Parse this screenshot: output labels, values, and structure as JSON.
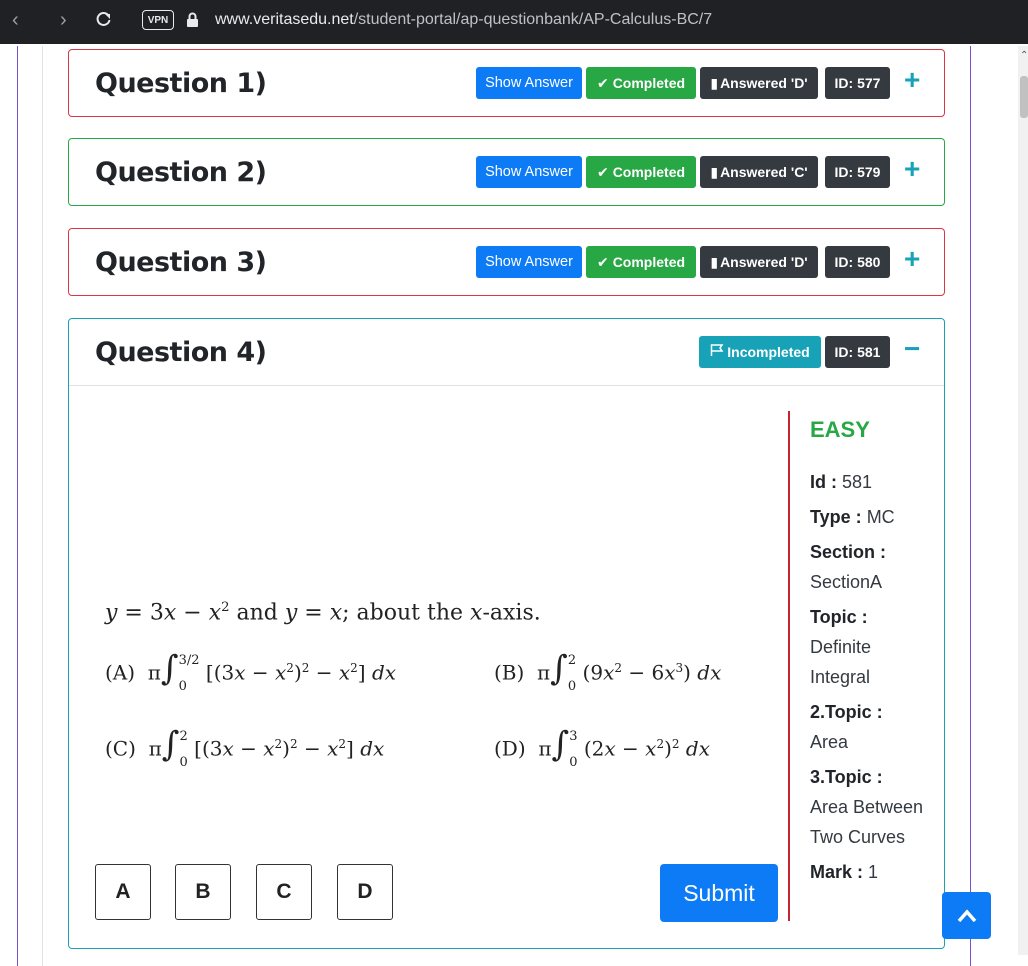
{
  "browser": {
    "url_host": "www.veritasedu.net",
    "url_path": "/student-portal/ap-questionbank/AP-Calculus-BC/7",
    "vpn_label": "VPN"
  },
  "questions": [
    {
      "title": "Question 1)",
      "show_answer": "Show Answer",
      "status": "Completed",
      "answered": "Answered 'D'",
      "id": "ID: 577",
      "toggle": "+",
      "border": "#dc3545"
    },
    {
      "title": "Question 2)",
      "show_answer": "Show Answer",
      "status": "Completed",
      "answered": "Answered 'C'",
      "id": "ID: 579",
      "toggle": "+",
      "border": "#28a745"
    },
    {
      "title": "Question 3)",
      "show_answer": "Show Answer",
      "status": "Completed",
      "answered": "Answered 'D'",
      "id": "ID: 580",
      "toggle": "+",
      "border": "#dc3545"
    },
    {
      "title": "Question 4)",
      "status": "Incompleted",
      "id": "ID: 581",
      "toggle": "−",
      "border": "#17a2b8"
    }
  ],
  "q4": {
    "stem": "y = 3x − x² and y = x; about the x-axis.",
    "options": {
      "A": {
        "label": "(A)",
        "expr": "π ∫₀^{3/2} [(3x − x²)² − x²] dx"
      },
      "B": {
        "label": "(B)",
        "expr": "π ∫₀^{2} (9x² − 6x³) dx"
      },
      "C": {
        "label": "(C)",
        "expr": "π ∫₀^{2} [(3x − x²)² − x²] dx"
      },
      "D": {
        "label": "(D)",
        "expr": "π ∫₀^{3} (2x − x²)² dx"
      }
    },
    "answer_buttons": [
      "A",
      "B",
      "C",
      "D"
    ],
    "submit": "Submit",
    "difficulty": "EASY",
    "meta": {
      "id_label": "Id :",
      "id_value": "581",
      "type_label": "Type :",
      "type_value": "MC",
      "section_label": "Section :",
      "section_value": "SectionA",
      "topic_label": "Topic :",
      "topic_value": "Definite Integral",
      "topic2_label": "2.Topic :",
      "topic2_value": "Area",
      "topic3_label": "3.Topic :",
      "topic3_value": "Area Between Two Curves",
      "mark_label": "Mark :",
      "mark_value": "1"
    }
  }
}
